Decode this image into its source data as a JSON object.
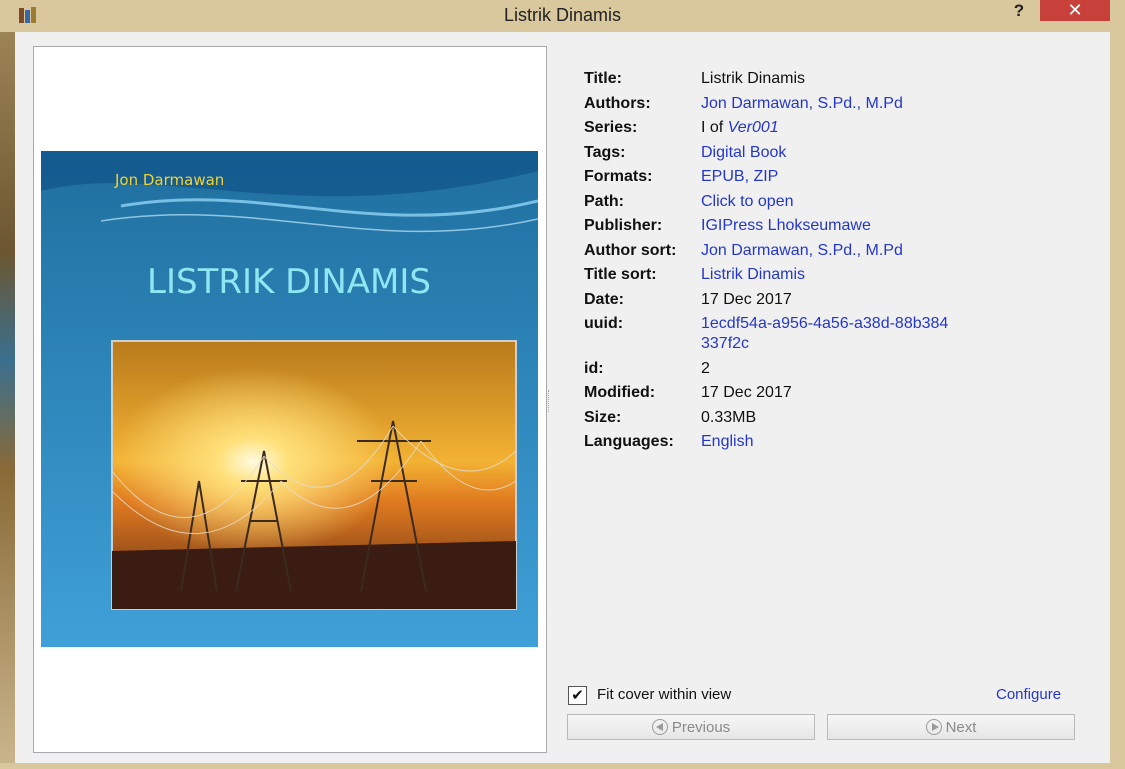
{
  "window": {
    "title": "Listrik Dinamis",
    "help": "?",
    "close": "✕"
  },
  "cover": {
    "author": "Jon Darmawan",
    "title": "LISTRIK DINAMIS"
  },
  "metadata": {
    "title": {
      "label": "Title:",
      "value": "Listrik Dinamis"
    },
    "authors": {
      "label": "Authors:",
      "value": "Jon Darmawan, S.Pd., M.Pd"
    },
    "series": {
      "label": "Series:",
      "prefix": "I of ",
      "name": "Ver001"
    },
    "tags": {
      "label": "Tags:",
      "value": "Digital Book"
    },
    "formats": {
      "label": "Formats:",
      "value": "EPUB, ZIP"
    },
    "path": {
      "label": "Path:",
      "value": "Click to open"
    },
    "publisher": {
      "label": "Publisher:",
      "value": "IGIPress Lhokseumawe"
    },
    "author_sort": {
      "label": "Author sort:",
      "value": "Jon Darmawan, S.Pd., M.Pd"
    },
    "title_sort": {
      "label": "Title sort:",
      "value": "Listrik Dinamis"
    },
    "date": {
      "label": "Date:",
      "value": "17 Dec 2017"
    },
    "uuid": {
      "label": "uuid:",
      "value": "1ecdf54a-a956-4a56-a38d-88b384337f2c"
    },
    "id": {
      "label": "id:",
      "value": "2"
    },
    "modified": {
      "label": "Modified:",
      "value": "17 Dec 2017"
    },
    "size": {
      "label": "Size:",
      "value": "0.33MB"
    },
    "languages": {
      "label": "Languages:",
      "value": "English"
    }
  },
  "controls": {
    "fit_cover_label": "Fit cover within view",
    "fit_cover_checked": true,
    "check_mark": "✔",
    "configure": "Configure",
    "previous": "Previous",
    "next": "Next"
  },
  "colors": {
    "title_bar": "#d9c79e",
    "close_button": "#c7413a",
    "link": "#2437c9",
    "cover_blue": "#2f86c0"
  }
}
